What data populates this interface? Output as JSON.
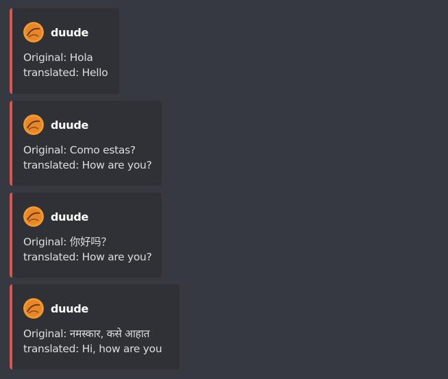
{
  "colors": {
    "background": "#36393f",
    "embed_background": "#2f3136",
    "embed_accent": "#e0524b",
    "author_text": "#ffffff",
    "body_text": "#dcddde"
  },
  "embeds": [
    {
      "author": {
        "name": "duude",
        "avatar_icon": "orange-avatar-icon"
      },
      "original": "Original: Hola",
      "translated": "translated: Hello"
    },
    {
      "author": {
        "name": "duude",
        "avatar_icon": "orange-avatar-icon"
      },
      "original": "Original: Como estas?",
      "translated": "translated: How are you?"
    },
    {
      "author": {
        "name": "duude",
        "avatar_icon": "orange-avatar-icon"
      },
      "original": "Original: 你好吗？",
      "translated": "translated: How are you?"
    },
    {
      "author": {
        "name": "duude",
        "avatar_icon": "orange-avatar-icon"
      },
      "original": "Original: नमस्कार, कसे आहात",
      "translated": "translated: Hi, how are you"
    }
  ]
}
